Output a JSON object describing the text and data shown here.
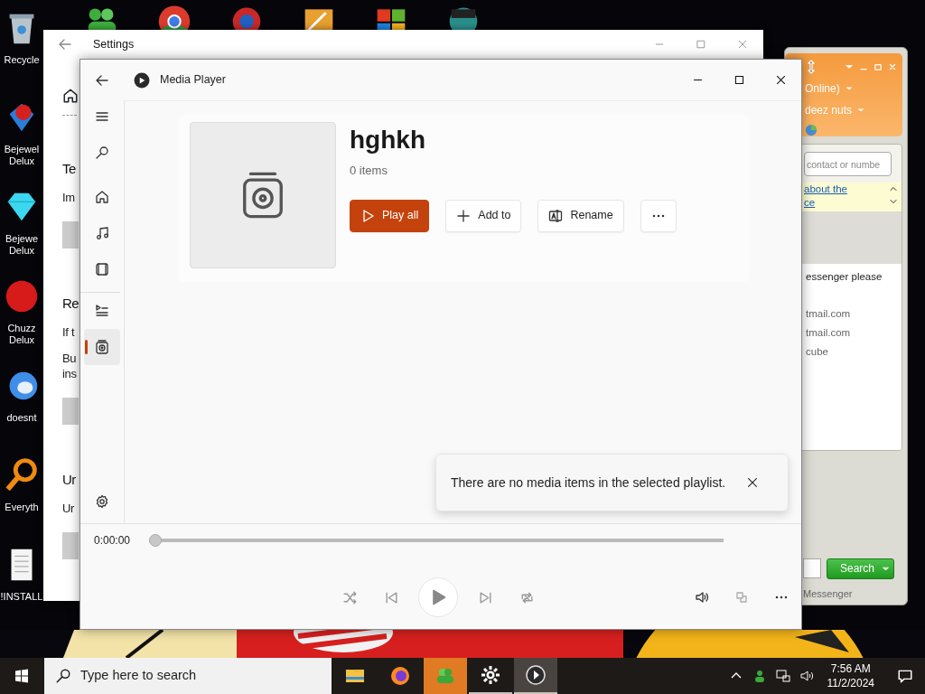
{
  "desktop": {
    "icons": [
      {
        "kind": "bin",
        "lines": [
          "Recycle"
        ]
      },
      {
        "kind": "gem2",
        "lines": [
          "Bejewel",
          "Delux"
        ]
      },
      {
        "kind": "gem",
        "lines": [
          "Bejewe",
          "Delux"
        ]
      },
      {
        "kind": "blob",
        "lines": [
          "Chuzz",
          "Delux"
        ]
      },
      {
        "kind": "bird",
        "lines": [
          "doesnt"
        ]
      },
      {
        "kind": "magnifier",
        "lines": [
          "Everyth"
        ]
      },
      {
        "kind": "doc",
        "lines": [
          "!INSTALL"
        ]
      }
    ],
    "top_icons": [
      {
        "kind": "people"
      },
      {
        "kind": "chrome"
      },
      {
        "kind": "ring"
      },
      {
        "kind": "box"
      },
      {
        "kind": "tiles"
      },
      {
        "kind": "figure"
      }
    ]
  },
  "settings_window": {
    "title": "Settings",
    "sections": [
      {
        "heading": "Te",
        "paragraphs": [
          [
            "Im"
          ]
        ],
        "has_button": true
      },
      {
        "heading": "Re",
        "paragraphs": [
          [
            "If t"
          ],
          [
            "Bu",
            "ins"
          ]
        ],
        "has_button": true
      },
      {
        "heading": "Ur",
        "paragraphs": [
          [
            "Ur"
          ]
        ],
        "has_button": true
      }
    ]
  },
  "messenger_window": {
    "status": "Online)",
    "name": "deez nuts",
    "search_placeholder": "contact or numbe",
    "link_lines": [
      "about the",
      "ce"
    ],
    "list": [
      {
        "text": "essenger please",
        "kind": "heading"
      },
      {
        "text": "tmail.com",
        "kind": "contact"
      },
      {
        "text": "tmail.com",
        "kind": "contact"
      },
      {
        "text": "cube",
        "kind": "contact"
      }
    ],
    "search_button": "Search",
    "footer": "Messenger"
  },
  "media_player": {
    "title": "Media Player",
    "nav": [
      {
        "kind": "back",
        "selected": false
      },
      {
        "kind": "menu",
        "selected": false
      },
      {
        "kind": "search",
        "selected": false
      },
      {
        "kind": "home",
        "selected": false
      },
      {
        "kind": "music",
        "selected": false
      },
      {
        "kind": "video",
        "selected": false
      },
      {
        "kind": "queue",
        "selected": false
      },
      {
        "kind": "playlists",
        "selected": true
      },
      {
        "kind": "settings",
        "selected": false
      }
    ],
    "playlist": {
      "name": "hghkh",
      "count": "0 items",
      "actions": [
        {
          "kind": "play",
          "label": "Play all",
          "primary": true
        },
        {
          "kind": "add",
          "label": "Add to",
          "primary": false
        },
        {
          "kind": "rename",
          "label": "Rename",
          "primary": false
        },
        {
          "kind": "more",
          "primary": false
        }
      ]
    },
    "toast": {
      "message": "There are no media items in the selected playlist."
    },
    "player": {
      "time": "0:00:00",
      "level": 0,
      "controls": [
        {
          "kind": "shuffle"
        },
        {
          "kind": "prev"
        },
        {
          "kind": "play"
        },
        {
          "kind": "next"
        },
        {
          "kind": "repeat"
        }
      ],
      "extras": [
        {
          "kind": "volume"
        },
        {
          "kind": "mini"
        },
        {
          "kind": "more"
        }
      ]
    }
  },
  "taskbar": {
    "search_placeholder": "Type here to search",
    "apps": [
      {
        "kind": "folder",
        "open": false,
        "selected": false,
        "flashing": false
      },
      {
        "kind": "firefox",
        "open": false,
        "selected": false,
        "flashing": false
      },
      {
        "kind": "messenger",
        "open": false,
        "selected": false,
        "flashing": true
      },
      {
        "kind": "settings",
        "open": true,
        "selected": false,
        "flashing": false
      },
      {
        "kind": "mediaplayer",
        "open": true,
        "selected": true,
        "flashing": false
      }
    ],
    "tray": [
      {
        "kind": "chevron"
      },
      {
        "kind": "messenger"
      },
      {
        "kind": "network"
      },
      {
        "kind": "volume"
      }
    ],
    "time": "7:56 AM",
    "date": "11/2/2024"
  }
}
